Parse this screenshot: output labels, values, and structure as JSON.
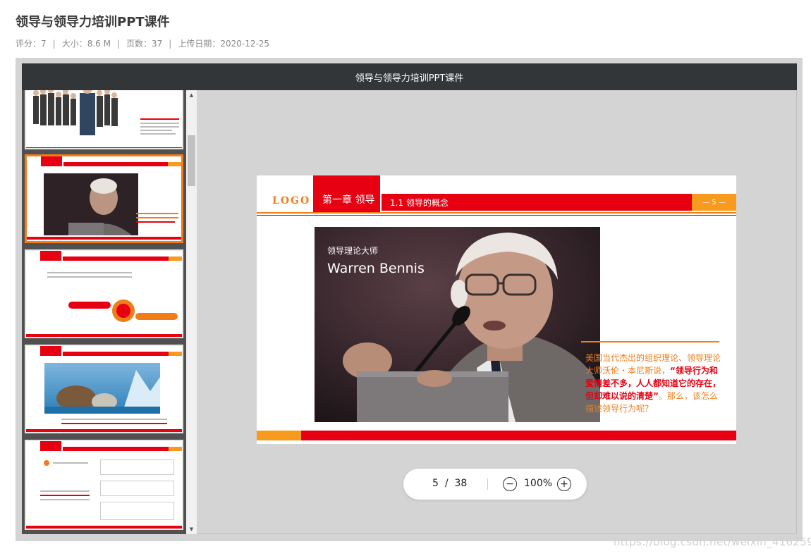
{
  "page": {
    "title": "领导与领导力培训PPT课件",
    "meta": {
      "rating": "评分：7",
      "size": "大小：8.6 M",
      "pages": "页数：37",
      "date": "上传日期：2020-12-25",
      "separator": "|"
    }
  },
  "viewer": {
    "title": "领导与领导力培训PPT课件",
    "thumbnails": [
      {
        "label": "slide-4",
        "active": false
      },
      {
        "label": "slide-5",
        "active": true
      },
      {
        "label": "slide-6",
        "active": false
      },
      {
        "label": "slide-7",
        "active": false
      },
      {
        "label": "slide-8",
        "active": false
      }
    ],
    "slide": {
      "logo": "LOGO",
      "chapter": "第一章 领导",
      "section": "1.1 领导的概念",
      "page_num": "— 5 —",
      "photo_sub": "领导理论大师",
      "photo_name": "Warren Bennis",
      "quote_a": "美国当代杰出的组织理论、领导理论大师沃伦・本尼斯说，",
      "quote_b": "“领导行为和爱情差不多，人人都知道它的存在，但却难以说的清楚”",
      "quote_c": "。那么，该怎么描述领导行为呢？"
    },
    "controls": {
      "current_page": "5",
      "slash": "/",
      "total_pages": "38",
      "zoom": "100%",
      "zoom_out_icon": "minus-circle-icon",
      "zoom_in_icon": "plus-circle-icon"
    }
  },
  "watermark": "https://blog.csdn.net/weixin_41625929",
  "colors": {
    "accent_red": "#e60012",
    "accent_orange": "#f07d19",
    "viewer_bar": "#323639"
  }
}
